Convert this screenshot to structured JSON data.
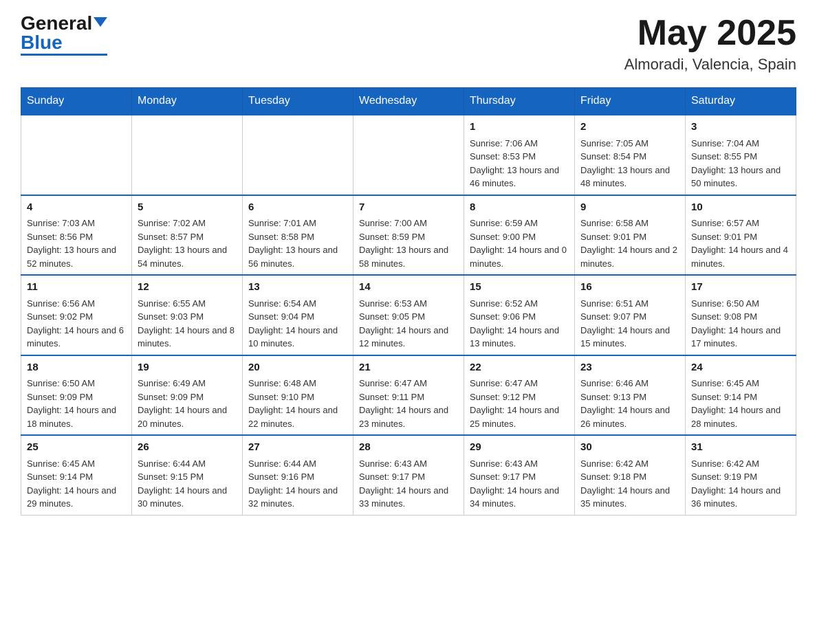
{
  "header": {
    "logo": {
      "general": "General",
      "blue": "Blue"
    },
    "title": "May 2025",
    "location": "Almoradi, Valencia, Spain"
  },
  "weekdays": [
    "Sunday",
    "Monday",
    "Tuesday",
    "Wednesday",
    "Thursday",
    "Friday",
    "Saturday"
  ],
  "weeks": [
    [
      {
        "day": "",
        "info": ""
      },
      {
        "day": "",
        "info": ""
      },
      {
        "day": "",
        "info": ""
      },
      {
        "day": "",
        "info": ""
      },
      {
        "day": "1",
        "info": "Sunrise: 7:06 AM\nSunset: 8:53 PM\nDaylight: 13 hours and 46 minutes."
      },
      {
        "day": "2",
        "info": "Sunrise: 7:05 AM\nSunset: 8:54 PM\nDaylight: 13 hours and 48 minutes."
      },
      {
        "day": "3",
        "info": "Sunrise: 7:04 AM\nSunset: 8:55 PM\nDaylight: 13 hours and 50 minutes."
      }
    ],
    [
      {
        "day": "4",
        "info": "Sunrise: 7:03 AM\nSunset: 8:56 PM\nDaylight: 13 hours and 52 minutes."
      },
      {
        "day": "5",
        "info": "Sunrise: 7:02 AM\nSunset: 8:57 PM\nDaylight: 13 hours and 54 minutes."
      },
      {
        "day": "6",
        "info": "Sunrise: 7:01 AM\nSunset: 8:58 PM\nDaylight: 13 hours and 56 minutes."
      },
      {
        "day": "7",
        "info": "Sunrise: 7:00 AM\nSunset: 8:59 PM\nDaylight: 13 hours and 58 minutes."
      },
      {
        "day": "8",
        "info": "Sunrise: 6:59 AM\nSunset: 9:00 PM\nDaylight: 14 hours and 0 minutes."
      },
      {
        "day": "9",
        "info": "Sunrise: 6:58 AM\nSunset: 9:01 PM\nDaylight: 14 hours and 2 minutes."
      },
      {
        "day": "10",
        "info": "Sunrise: 6:57 AM\nSunset: 9:01 PM\nDaylight: 14 hours and 4 minutes."
      }
    ],
    [
      {
        "day": "11",
        "info": "Sunrise: 6:56 AM\nSunset: 9:02 PM\nDaylight: 14 hours and 6 minutes."
      },
      {
        "day": "12",
        "info": "Sunrise: 6:55 AM\nSunset: 9:03 PM\nDaylight: 14 hours and 8 minutes."
      },
      {
        "day": "13",
        "info": "Sunrise: 6:54 AM\nSunset: 9:04 PM\nDaylight: 14 hours and 10 minutes."
      },
      {
        "day": "14",
        "info": "Sunrise: 6:53 AM\nSunset: 9:05 PM\nDaylight: 14 hours and 12 minutes."
      },
      {
        "day": "15",
        "info": "Sunrise: 6:52 AM\nSunset: 9:06 PM\nDaylight: 14 hours and 13 minutes."
      },
      {
        "day": "16",
        "info": "Sunrise: 6:51 AM\nSunset: 9:07 PM\nDaylight: 14 hours and 15 minutes."
      },
      {
        "day": "17",
        "info": "Sunrise: 6:50 AM\nSunset: 9:08 PM\nDaylight: 14 hours and 17 minutes."
      }
    ],
    [
      {
        "day": "18",
        "info": "Sunrise: 6:50 AM\nSunset: 9:09 PM\nDaylight: 14 hours and 18 minutes."
      },
      {
        "day": "19",
        "info": "Sunrise: 6:49 AM\nSunset: 9:09 PM\nDaylight: 14 hours and 20 minutes."
      },
      {
        "day": "20",
        "info": "Sunrise: 6:48 AM\nSunset: 9:10 PM\nDaylight: 14 hours and 22 minutes."
      },
      {
        "day": "21",
        "info": "Sunrise: 6:47 AM\nSunset: 9:11 PM\nDaylight: 14 hours and 23 minutes."
      },
      {
        "day": "22",
        "info": "Sunrise: 6:47 AM\nSunset: 9:12 PM\nDaylight: 14 hours and 25 minutes."
      },
      {
        "day": "23",
        "info": "Sunrise: 6:46 AM\nSunset: 9:13 PM\nDaylight: 14 hours and 26 minutes."
      },
      {
        "day": "24",
        "info": "Sunrise: 6:45 AM\nSunset: 9:14 PM\nDaylight: 14 hours and 28 minutes."
      }
    ],
    [
      {
        "day": "25",
        "info": "Sunrise: 6:45 AM\nSunset: 9:14 PM\nDaylight: 14 hours and 29 minutes."
      },
      {
        "day": "26",
        "info": "Sunrise: 6:44 AM\nSunset: 9:15 PM\nDaylight: 14 hours and 30 minutes."
      },
      {
        "day": "27",
        "info": "Sunrise: 6:44 AM\nSunset: 9:16 PM\nDaylight: 14 hours and 32 minutes."
      },
      {
        "day": "28",
        "info": "Sunrise: 6:43 AM\nSunset: 9:17 PM\nDaylight: 14 hours and 33 minutes."
      },
      {
        "day": "29",
        "info": "Sunrise: 6:43 AM\nSunset: 9:17 PM\nDaylight: 14 hours and 34 minutes."
      },
      {
        "day": "30",
        "info": "Sunrise: 6:42 AM\nSunset: 9:18 PM\nDaylight: 14 hours and 35 minutes."
      },
      {
        "day": "31",
        "info": "Sunrise: 6:42 AM\nSunset: 9:19 PM\nDaylight: 14 hours and 36 minutes."
      }
    ]
  ]
}
